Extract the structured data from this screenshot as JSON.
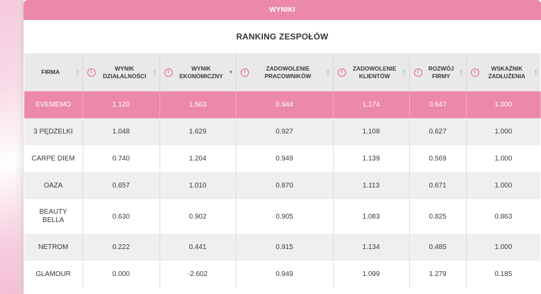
{
  "panel": {
    "header": "WYNIKI",
    "title": "RANKING ZESPOŁÓW"
  },
  "columns": [
    {
      "label": "FIRMA",
      "info": false,
      "sort": "none"
    },
    {
      "label": "WYNIK DZIAŁALNOŚCI",
      "info": true,
      "sort": "none"
    },
    {
      "label": "WYNIK EKONOMICZNY",
      "info": true,
      "sort": "desc"
    },
    {
      "label": "ZADOWOLENIE PRACOWNIKÓW",
      "info": true,
      "sort": "none"
    },
    {
      "label": "ZADOWOLENIE KLIENTÓW",
      "info": true,
      "sort": "none"
    },
    {
      "label": "ROZWÓJ FIRMY",
      "info": true,
      "sort": "none"
    },
    {
      "label": "WSKAŹNIK ZADŁUŻENIA",
      "info": true,
      "sort": "none"
    }
  ],
  "rows": [
    {
      "firm": "EVEMEMO",
      "values": [
        "1.120",
        "1.563",
        "0.944",
        "1.174",
        "0.647",
        "1.000"
      ]
    },
    {
      "firm": "3 PĘDZELKI",
      "values": [
        "1.048",
        "1.629",
        "0.927",
        "1.108",
        "0.627",
        "1.000"
      ]
    },
    {
      "firm": "CARPE DIEM",
      "values": [
        "0.740",
        "1.204",
        "0.949",
        "1.139",
        "0.569",
        "1.000"
      ]
    },
    {
      "firm": "OAZA",
      "values": [
        "0.657",
        "1.010",
        "0.870",
        "1.113",
        "0.671",
        "1.000"
      ]
    },
    {
      "firm": "BEAUTY BELLA",
      "values": [
        "0.630",
        "0.902",
        "0.905",
        "1.083",
        "0.825",
        "0.863"
      ]
    },
    {
      "firm": "NETROM",
      "values": [
        "0.222",
        "0.441",
        "0.915",
        "1.134",
        "0.485",
        "1.000"
      ]
    },
    {
      "firm": "GLAMOUR",
      "values": [
        "0.000",
        "-2.602",
        "0.949",
        "1.099",
        "1.279",
        "0.185"
      ]
    }
  ],
  "colors": {
    "accent": "#ec88ab",
    "info_icon": "#e3608f",
    "sort_active": "#6c6cd8"
  },
  "icons": {
    "info": "i",
    "sort_both": "⇕",
    "sort_desc": "▼"
  }
}
